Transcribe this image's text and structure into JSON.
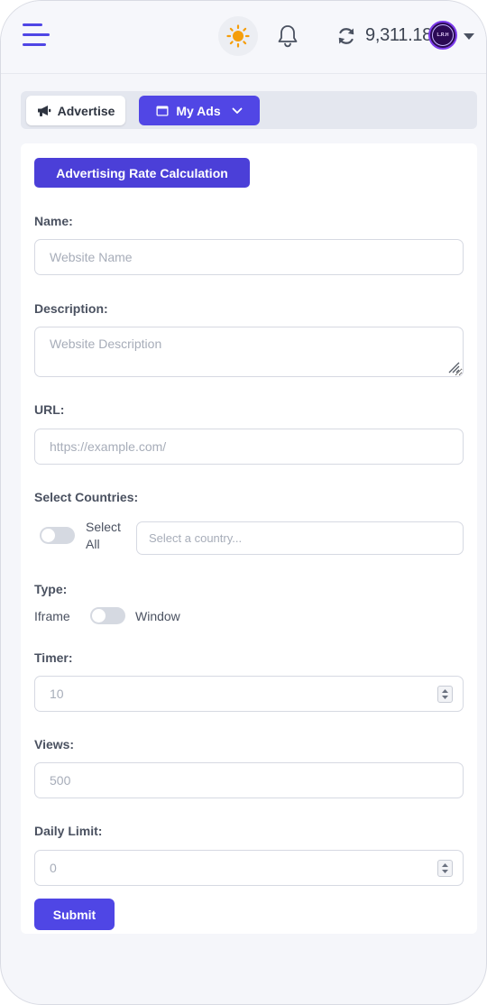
{
  "header": {
    "balance": "9,311.18",
    "avatar_text": "L.R.H",
    "icons": [
      "hamburger-icon",
      "sun-icon",
      "bell-icon",
      "refresh-icon",
      "caret-down-icon"
    ]
  },
  "tabs": {
    "advertise_label": "Advertise",
    "my_ads_label": "My Ads"
  },
  "form": {
    "title": "Advertising Rate Calculation",
    "name_label": "Name:",
    "name_placeholder": "Website Name",
    "description_label": "Description:",
    "description_placeholder": "Website Description",
    "url_label": "URL:",
    "url_placeholder": "https://example.com/",
    "countries_label": "Select Countries:",
    "select_all_line1": "Select",
    "select_all_line2": "All",
    "country_placeholder": "Select a country...",
    "type_label": "Type:",
    "type_option_left": "Iframe",
    "type_option_right": "Window",
    "timer_label": "Timer:",
    "timer_placeholder": "10",
    "views_label": "Views:",
    "views_placeholder": "500",
    "daily_limit_label": "Daily Limit:",
    "daily_limit_placeholder": "0",
    "submit_label": "Submit"
  },
  "colors": {
    "accent": "#4f46e5",
    "title_button": "#4b3fd8",
    "sun": "#f59e0b"
  }
}
